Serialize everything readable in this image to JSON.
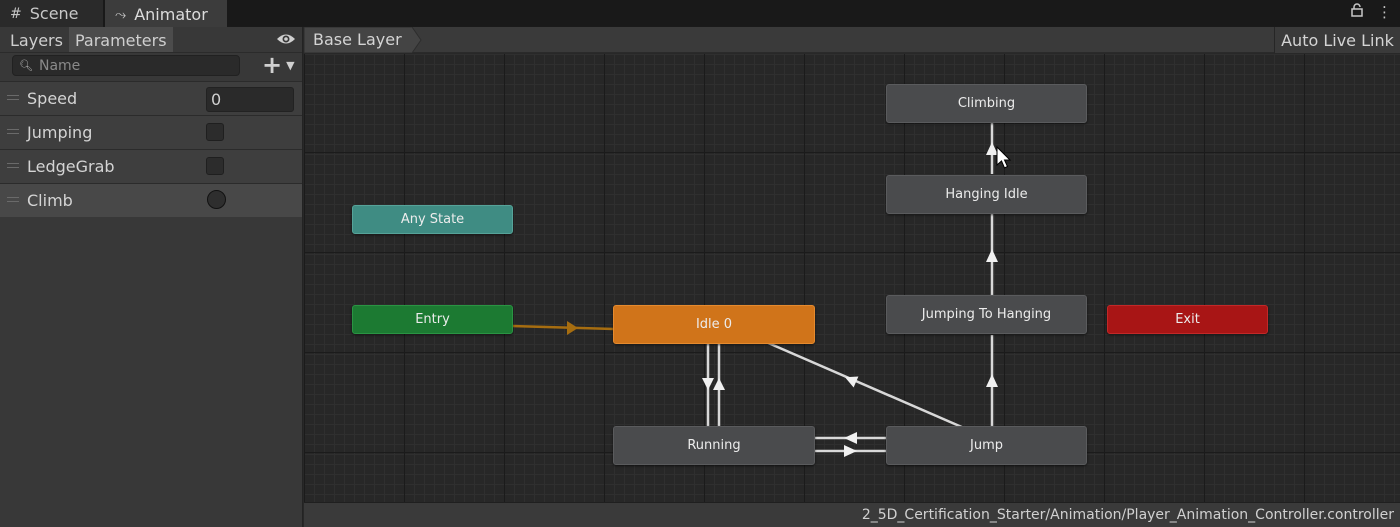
{
  "tabs": [
    {
      "label": "Scene",
      "icon": "grid-icon"
    },
    {
      "label": "Animator",
      "icon": "animator-icon"
    }
  ],
  "window_icons": [
    "lock-icon",
    "kebab-menu-icon"
  ],
  "left_panel": {
    "tabs": [
      "Layers",
      "Parameters"
    ],
    "active_tab": "Parameters",
    "search": {
      "placeholder": "Name",
      "value": ""
    },
    "parameters": [
      {
        "name": "Speed",
        "type": "float",
        "value": "0"
      },
      {
        "name": "Jumping",
        "type": "bool",
        "value": false
      },
      {
        "name": "LedgeGrab",
        "type": "bool",
        "value": false
      },
      {
        "name": "Climb",
        "type": "trigger",
        "value": false,
        "selected": true
      }
    ]
  },
  "graph_header": {
    "breadcrumb": "Base Layer",
    "live_link": "Auto Live Link"
  },
  "states": {
    "any_state": "Any State",
    "entry": "Entry",
    "exit": "Exit",
    "idle": "Idle 0",
    "running": "Running",
    "jump": "Jump",
    "jumping_to_hanging": "Jumping To Hanging",
    "hanging_idle": "Hanging Idle",
    "climbing": "Climbing"
  },
  "colors": {
    "any_state": "#3f8c83",
    "entry": "#1c7a32",
    "exit": "#a81515",
    "default_state": "#d0741a",
    "state": "#4a4b4d",
    "default_transition": "#a66d10",
    "transition": "#d8d8d8"
  },
  "status_path": "2_5D_Certification_Starter/Animation/Player_Animation_Controller.controller"
}
